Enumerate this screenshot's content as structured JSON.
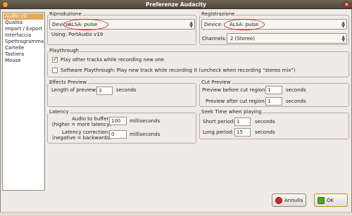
{
  "window": {
    "title": "Preferenze Audacity"
  },
  "sidebar": {
    "items": [
      {
        "label": "Audio I/O",
        "selected": true
      },
      {
        "label": "Qualità"
      },
      {
        "label": "Import / Export"
      },
      {
        "label": "Interfaccia"
      },
      {
        "label": "Spettrogramma"
      },
      {
        "label": "Cartelle"
      },
      {
        "label": "Tastiera"
      },
      {
        "label": "Mouse"
      }
    ]
  },
  "playback": {
    "title": "Riproduzione",
    "device_label": "Device:",
    "device_value": "ALSA: pulse",
    "using_text": "Using: PortAudio v19"
  },
  "recording": {
    "title": "Registrazione",
    "device_label": "Device:",
    "device_value": "ALSA: pulse",
    "channels_label": "Channels:",
    "channels_value": "2 (Stereo)"
  },
  "playthrough": {
    "title": "Playthrough",
    "option1": "Play other tracks while recording new one",
    "option1_checked": true,
    "option2": "Software Playthrough: Play new track while recording it (uncheck when recording \"stereo mix\")",
    "option2_checked": false
  },
  "effects_preview": {
    "title": "Effects Preview",
    "length_label": "Length of preview:",
    "length_value": "3",
    "unit": "seconds"
  },
  "cut_preview": {
    "title": "Cut Preview",
    "before_label": "Preview before cut region:",
    "before_value": "1",
    "after_label": "Preview after cut region:",
    "after_value": "1",
    "unit": "seconds"
  },
  "latency": {
    "title": "Latency",
    "buffer_label1": "Audio to buffer:",
    "buffer_label2": "(higher = more latency)",
    "buffer_value": "100",
    "buffer_unit": "milliseconds",
    "correction_label1": "Latency correction:",
    "correction_label2": "(negative = backwards)",
    "correction_value": "0",
    "correction_unit": "milliseconds"
  },
  "seek": {
    "title": "Seek Time when playing",
    "short_label": "Short period:",
    "short_value": "1",
    "long_label": "Long period:",
    "long_value": "15",
    "unit": "seconds"
  },
  "buttons": {
    "cancel": "Annulla",
    "ok": "OK"
  },
  "colors": {
    "accent": "#e3aa5a",
    "highlight_circle": "#d8242a",
    "window_bg": "#efebe6"
  }
}
